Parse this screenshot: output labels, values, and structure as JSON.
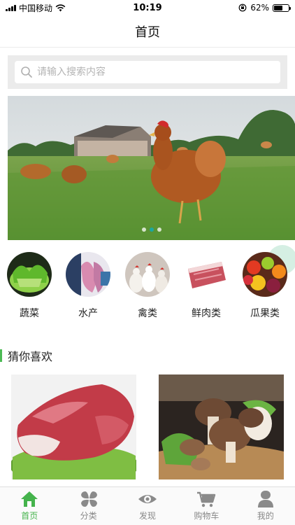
{
  "status_bar": {
    "carrier": "中国移动",
    "time": "10:19",
    "battery": "62%",
    "battery_level": 0.62
  },
  "header": {
    "title": "首页"
  },
  "search": {
    "placeholder": "请输入搜索内容"
  },
  "banner": {
    "slide_count": 3,
    "active_index": 1
  },
  "categories": [
    {
      "label": "蔬菜"
    },
    {
      "label": "水产"
    },
    {
      "label": "禽类"
    },
    {
      "label": "鲜肉类"
    },
    {
      "label": "瓜果类"
    }
  ],
  "recommend": {
    "title": "猜你喜欢"
  },
  "tabs": [
    {
      "label": "首页",
      "icon": "home-icon",
      "active": true
    },
    {
      "label": "分类",
      "icon": "category-icon",
      "active": false
    },
    {
      "label": "发现",
      "icon": "eye-icon",
      "active": false
    },
    {
      "label": "购物车",
      "icon": "cart-icon",
      "active": false
    },
    {
      "label": "我的",
      "icon": "user-icon",
      "active": false
    }
  ],
  "colors": {
    "accent": "#45b34c",
    "dot_active": "#1aa8a0",
    "search_bg": "#ebebeb"
  }
}
